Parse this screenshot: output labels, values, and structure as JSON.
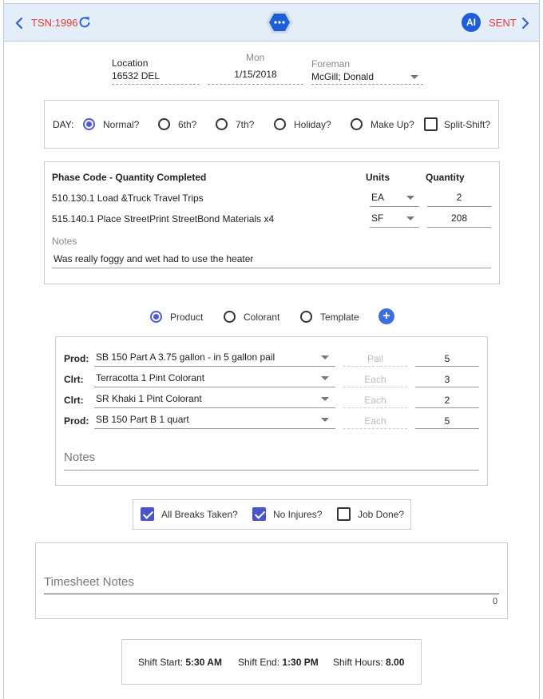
{
  "header": {
    "tsn": "TSN:1996",
    "ai_badge": "AI",
    "status": "SENT"
  },
  "info": {
    "location_label": "Location",
    "location_value": "16532 DEL",
    "day_name": "Mon",
    "date": "1/15/2018",
    "foreman_label": "Foreman",
    "foreman_value": "McGill; Donald"
  },
  "day": {
    "label": "DAY:",
    "options": [
      "Normal?",
      "6th?",
      "7th?",
      "Holiday?",
      "Make Up?"
    ],
    "selected": "Normal?",
    "split_shift": "Split-Shift?"
  },
  "phase": {
    "header_code": "Phase Code - Quantity Completed",
    "header_units": "Units",
    "header_quantity": "Quantity",
    "rows": [
      {
        "code": "510.130.1 Load &Truck Travel Trips",
        "unit": "EA",
        "qty": "2"
      },
      {
        "code": "515.140.1 Place StreetPrint StreetBond Materials x4",
        "unit": "SF",
        "qty": "208"
      }
    ],
    "notes_label": "Notes",
    "notes_value": "Was really foggy and wet had to use the heater"
  },
  "type_selector": {
    "options": [
      "Product",
      "Colorant",
      "Template"
    ],
    "selected": "Product"
  },
  "materials": {
    "rows": [
      {
        "kind": "Prod:",
        "item": "SB 150 Part A 3.75 gallon - in 5 gallon pail",
        "unit": "Pail",
        "qty": "5"
      },
      {
        "kind": "Clrt:",
        "item": "Terracotta 1 Pint Colorant",
        "unit": "Each",
        "qty": "3"
      },
      {
        "kind": "Clrt:",
        "item": "SR Khaki 1 Pint Colorant",
        "unit": "Each",
        "qty": "2"
      },
      {
        "kind": "Prod:",
        "item": "SB 150 Part B 1 quart",
        "unit": "Each",
        "qty": "5"
      }
    ],
    "notes_placeholder": "Notes"
  },
  "checks": {
    "breaks": "All Breaks Taken?",
    "injuries": "No Injures?",
    "job_done": "Job Done?"
  },
  "timesheet": {
    "notes_placeholder": "Timesheet Notes",
    "char_count": "0"
  },
  "shift": {
    "start_label": "Shift Start:",
    "start_value": "5:30 AM",
    "end_label": "Shift End:",
    "end_value": "1:30 PM",
    "hours_label": "Shift Hours:",
    "hours_value": "8.00"
  },
  "colors": {
    "accent": "#2c63d6",
    "alert": "#e53935",
    "radio": "#4f5bd5"
  }
}
